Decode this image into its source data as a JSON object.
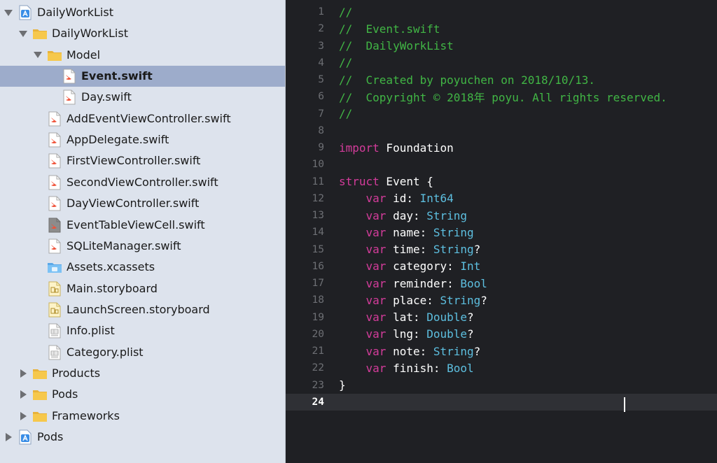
{
  "navigator": {
    "items": [
      {
        "label": "DailyWorkList",
        "icon": "xcode-project-icon",
        "expand": "open",
        "depth": 0
      },
      {
        "label": "DailyWorkList",
        "icon": "folder-icon",
        "expand": "open",
        "depth": 1
      },
      {
        "label": "Model",
        "icon": "folder-icon",
        "expand": "open",
        "depth": 2
      },
      {
        "label": "Event.swift",
        "icon": "swift-file-icon",
        "expand": "none",
        "depth": 3,
        "selected": true
      },
      {
        "label": "Day.swift",
        "icon": "swift-file-icon",
        "expand": "none",
        "depth": 3
      },
      {
        "label": "AddEventViewController.swift",
        "icon": "swift-file-icon",
        "expand": "none",
        "depth": 2
      },
      {
        "label": "AppDelegate.swift",
        "icon": "swift-file-icon",
        "expand": "none",
        "depth": 2
      },
      {
        "label": "FirstViewController.swift",
        "icon": "swift-file-icon",
        "expand": "none",
        "depth": 2
      },
      {
        "label": "SecondViewController.swift",
        "icon": "swift-file-icon",
        "expand": "none",
        "depth": 2
      },
      {
        "label": "DayViewController.swift",
        "icon": "swift-file-icon",
        "expand": "none",
        "depth": 2
      },
      {
        "label": "EventTableViewCell.swift",
        "icon": "swift-file-gray-icon",
        "expand": "none",
        "depth": 2
      },
      {
        "label": "SQLiteManager.swift",
        "icon": "swift-file-icon",
        "expand": "none",
        "depth": 2
      },
      {
        "label": "Assets.xcassets",
        "icon": "asset-catalog-icon",
        "expand": "none",
        "depth": 2
      },
      {
        "label": "Main.storyboard",
        "icon": "storyboard-icon",
        "expand": "none",
        "depth": 2
      },
      {
        "label": "LaunchScreen.storyboard",
        "icon": "storyboard-icon",
        "expand": "none",
        "depth": 2
      },
      {
        "label": "Info.plist",
        "icon": "plist-icon",
        "expand": "none",
        "depth": 2
      },
      {
        "label": "Category.plist",
        "icon": "plist-icon",
        "expand": "none",
        "depth": 2
      },
      {
        "label": "Products",
        "icon": "folder-icon",
        "expand": "closed",
        "depth": 1
      },
      {
        "label": "Pods",
        "icon": "folder-icon",
        "expand": "closed",
        "depth": 1
      },
      {
        "label": "Frameworks",
        "icon": "folder-icon",
        "expand": "closed",
        "depth": 1
      },
      {
        "label": "Pods",
        "icon": "xcode-project-icon",
        "expand": "closed",
        "depth": 0
      }
    ]
  },
  "editor": {
    "current_line": 24,
    "lines": [
      {
        "num": "1",
        "tokens": [
          {
            "t": "//",
            "k": "comment"
          }
        ]
      },
      {
        "num": "2",
        "tokens": [
          {
            "t": "//  Event.swift",
            "k": "comment"
          }
        ]
      },
      {
        "num": "3",
        "tokens": [
          {
            "t": "//  DailyWorkList",
            "k": "comment"
          }
        ]
      },
      {
        "num": "4",
        "tokens": [
          {
            "t": "//",
            "k": "comment"
          }
        ]
      },
      {
        "num": "5",
        "tokens": [
          {
            "t": "//  Created by poyuchen on 2018/10/13.",
            "k": "comment"
          }
        ]
      },
      {
        "num": "6",
        "tokens": [
          {
            "t": "//  Copyright © 2018年 poyu. All rights reserved.",
            "k": "comment"
          }
        ]
      },
      {
        "num": "7",
        "tokens": [
          {
            "t": "//",
            "k": "comment"
          }
        ]
      },
      {
        "num": "8",
        "tokens": []
      },
      {
        "num": "9",
        "tokens": [
          {
            "t": "import",
            "k": "keyword"
          },
          {
            "t": " Foundation",
            "k": "plain"
          }
        ]
      },
      {
        "num": "10",
        "tokens": []
      },
      {
        "num": "11",
        "tokens": [
          {
            "t": "struct",
            "k": "keyword"
          },
          {
            "t": " Event {",
            "k": "plain"
          }
        ]
      },
      {
        "num": "12",
        "tokens": [
          {
            "t": "    ",
            "k": "plain"
          },
          {
            "t": "var",
            "k": "keyword"
          },
          {
            "t": " id: ",
            "k": "plain"
          },
          {
            "t": "Int64",
            "k": "type"
          }
        ]
      },
      {
        "num": "13",
        "tokens": [
          {
            "t": "    ",
            "k": "plain"
          },
          {
            "t": "var",
            "k": "keyword"
          },
          {
            "t": " day: ",
            "k": "plain"
          },
          {
            "t": "String",
            "k": "type"
          }
        ]
      },
      {
        "num": "14",
        "tokens": [
          {
            "t": "    ",
            "k": "plain"
          },
          {
            "t": "var",
            "k": "keyword"
          },
          {
            "t": " name: ",
            "k": "plain"
          },
          {
            "t": "String",
            "k": "type"
          }
        ]
      },
      {
        "num": "15",
        "tokens": [
          {
            "t": "    ",
            "k": "plain"
          },
          {
            "t": "var",
            "k": "keyword"
          },
          {
            "t": " time: ",
            "k": "plain"
          },
          {
            "t": "String",
            "k": "type"
          },
          {
            "t": "?",
            "k": "plain"
          }
        ]
      },
      {
        "num": "16",
        "tokens": [
          {
            "t": "    ",
            "k": "plain"
          },
          {
            "t": "var",
            "k": "keyword"
          },
          {
            "t": " category: ",
            "k": "plain"
          },
          {
            "t": "Int",
            "k": "type"
          }
        ]
      },
      {
        "num": "17",
        "tokens": [
          {
            "t": "    ",
            "k": "plain"
          },
          {
            "t": "var",
            "k": "keyword"
          },
          {
            "t": " reminder: ",
            "k": "plain"
          },
          {
            "t": "Bool",
            "k": "type"
          }
        ]
      },
      {
        "num": "18",
        "tokens": [
          {
            "t": "    ",
            "k": "plain"
          },
          {
            "t": "var",
            "k": "keyword"
          },
          {
            "t": " place: ",
            "k": "plain"
          },
          {
            "t": "String",
            "k": "type"
          },
          {
            "t": "?",
            "k": "plain"
          }
        ]
      },
      {
        "num": "19",
        "tokens": [
          {
            "t": "    ",
            "k": "plain"
          },
          {
            "t": "var",
            "k": "keyword"
          },
          {
            "t": " lat: ",
            "k": "plain"
          },
          {
            "t": "Double",
            "k": "type"
          },
          {
            "t": "?",
            "k": "plain"
          }
        ]
      },
      {
        "num": "20",
        "tokens": [
          {
            "t": "    ",
            "k": "plain"
          },
          {
            "t": "var",
            "k": "keyword"
          },
          {
            "t": " lng: ",
            "k": "plain"
          },
          {
            "t": "Double",
            "k": "type"
          },
          {
            "t": "?",
            "k": "plain"
          }
        ]
      },
      {
        "num": "21",
        "tokens": [
          {
            "t": "    ",
            "k": "plain"
          },
          {
            "t": "var",
            "k": "keyword"
          },
          {
            "t": " note: ",
            "k": "plain"
          },
          {
            "t": "String",
            "k": "type"
          },
          {
            "t": "?",
            "k": "plain"
          }
        ]
      },
      {
        "num": "22",
        "tokens": [
          {
            "t": "    ",
            "k": "plain"
          },
          {
            "t": "var",
            "k": "keyword"
          },
          {
            "t": " finish: ",
            "k": "plain"
          },
          {
            "t": "Bool",
            "k": "type"
          }
        ]
      },
      {
        "num": "23",
        "tokens": [
          {
            "t": "}",
            "k": "plain"
          }
        ]
      },
      {
        "num": "24",
        "tokens": []
      }
    ]
  },
  "colors": {
    "comment": "#41b645",
    "keyword": "#d43c9b",
    "type": "#5dbfe0",
    "plain": "#ffffff",
    "editor_background": "#1f2024",
    "navigator_background": "#dde3ed",
    "selection": "#9daccb"
  }
}
